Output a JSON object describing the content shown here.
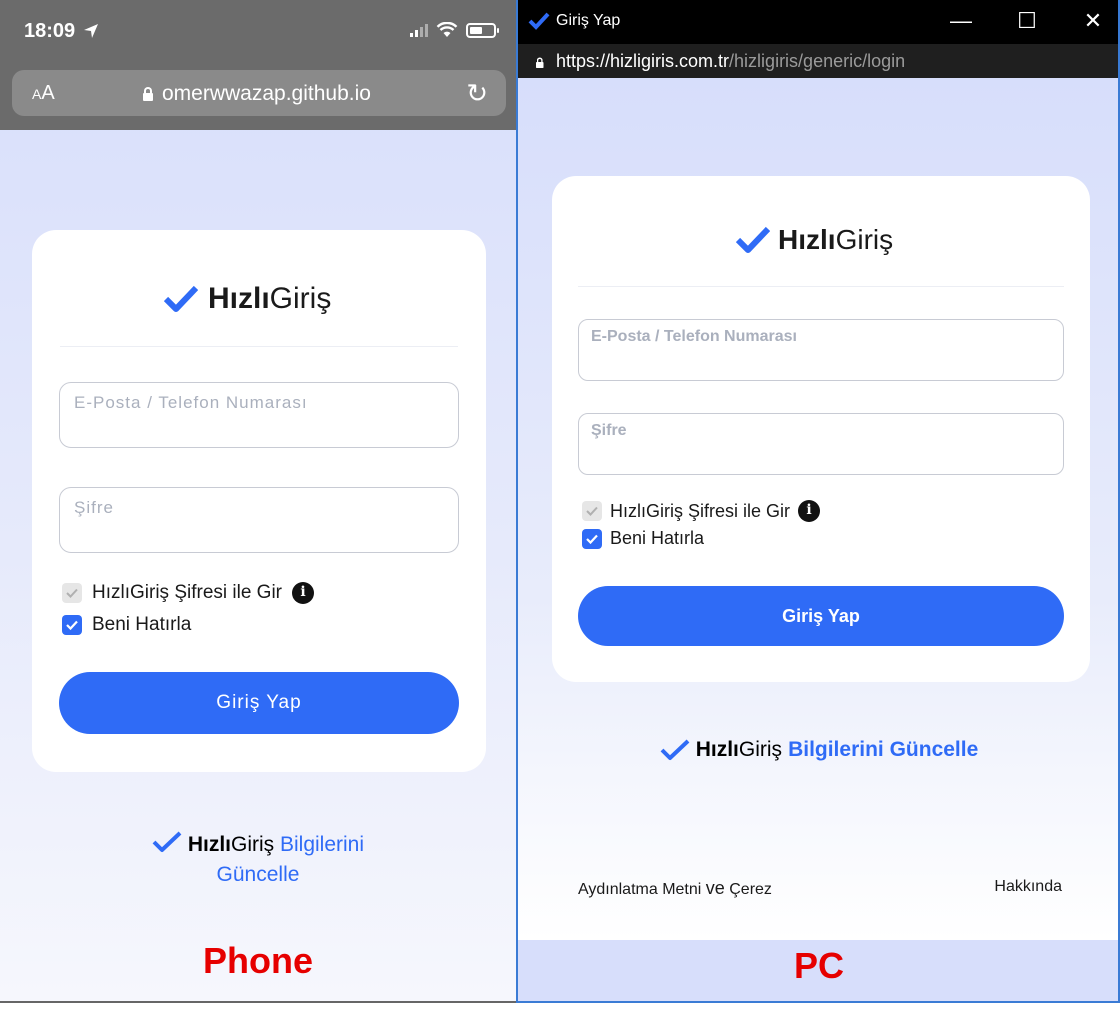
{
  "phone": {
    "status": {
      "time": "18:09"
    },
    "urlbar": {
      "aa_small": "A",
      "aa_big": "A",
      "url": "omerwwazap.github.io"
    },
    "card": {
      "brand_bold": "Hızlı",
      "brand_regular": "Giriş",
      "email_placeholder": "E-Posta / Telefon Numarası",
      "password_placeholder": "Şifre",
      "option_password_login": "HızlıGiriş Şifresi ile Gir",
      "option_remember": "Beni Hatırla",
      "submit_label": "Giriş Yap"
    },
    "update": {
      "brand_bold": "Hızlı",
      "brand_regular": "Giriş",
      "link_line1": "Bilgilerini",
      "link_line2": "Güncelle"
    },
    "label": "Phone"
  },
  "pc": {
    "window": {
      "title": "Giriş Yap",
      "minimize": "—",
      "maximize": "☐",
      "close": "✕"
    },
    "urlbar": {
      "url_host": "https://hizligiris.com.tr",
      "url_path": "/hizligiris/generic/login"
    },
    "card": {
      "brand_bold": "Hızlı",
      "brand_regular": "Giriş",
      "email_placeholder": "E-Posta / Telefon Numarası",
      "password_placeholder": "Şifre",
      "option_password_login": "HızlıGiriş Şifresi ile Gir",
      "option_remember": "Beni Hatırla",
      "submit_label": "Giriş Yap"
    },
    "update": {
      "brand_bold": "Hızlı",
      "brand_regular": "Giriş",
      "link": "Bilgilerini Güncelle"
    },
    "footer": {
      "left_a": "Aydınlatma Metni",
      "left_ve": "ve",
      "left_b": "Çerez",
      "right": "Hakkında"
    },
    "label": "PC"
  },
  "colors": {
    "accent": "#2f6bf6",
    "label_red": "#e60000",
    "bg_tint": "#d7defb"
  },
  "icons": [
    "checkmark-logo-icon",
    "location-arrow-icon",
    "signal-icon",
    "wifi-icon",
    "battery-icon",
    "lock-icon",
    "reload-icon",
    "info-icon",
    "checkbox-check-icon"
  ]
}
